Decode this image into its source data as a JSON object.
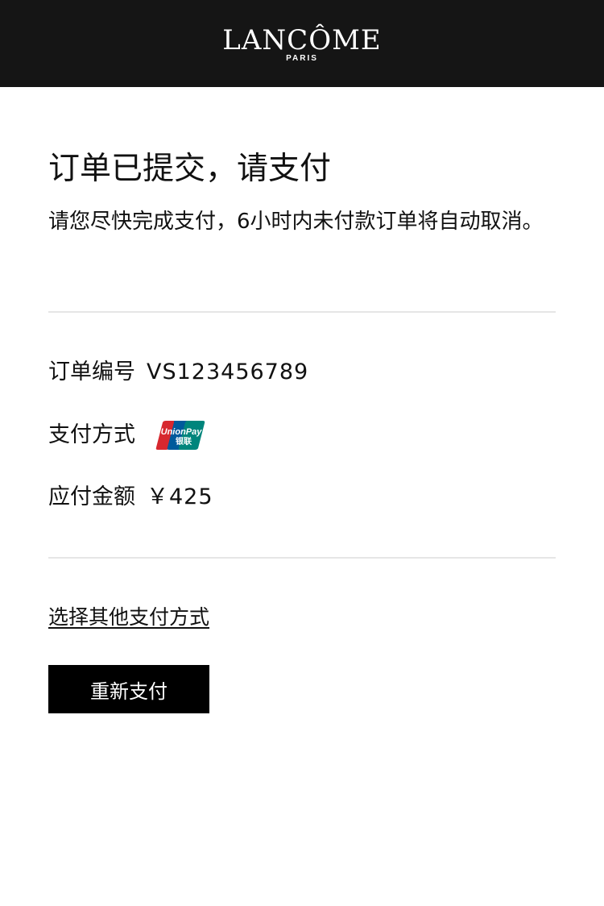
{
  "header": {
    "brand": "LANCÔME",
    "brand_sub": "PARIS"
  },
  "main": {
    "title": "订单已提交，请支付",
    "subtitle": "请您尽快完成支付，6小时内未付款订单将自动取消。",
    "order": {
      "label": "订单编号",
      "value": "VS123456789"
    },
    "payment_method": {
      "label": "支付方式",
      "icon": "unionpay-logo",
      "logo_text": "UnionPay 银联"
    },
    "amount": {
      "label": "应付金额",
      "value": "￥425"
    },
    "other_method_link": "选择其他支付方式",
    "repay_button": "重新支付"
  },
  "colors": {
    "header_bg": "#151515",
    "button_bg": "#000000",
    "divider": "#e6e6e6",
    "unionpay_red": "#d7282f",
    "unionpay_blue": "#005a9c",
    "unionpay_teal": "#00857c"
  }
}
